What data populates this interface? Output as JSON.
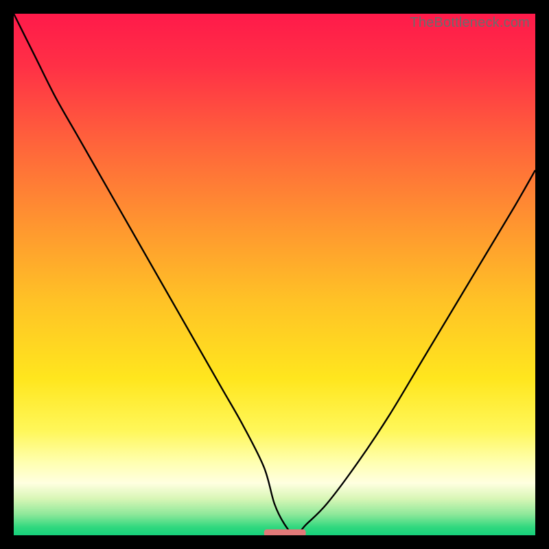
{
  "watermark": "TheBottleneck.com",
  "chart_data": {
    "type": "line",
    "title": "",
    "xlabel": "",
    "ylabel": "",
    "xlim": [
      0,
      100
    ],
    "ylim": [
      0,
      100
    ],
    "legend": false,
    "grid": false,
    "background_gradient": {
      "stops": [
        {
          "offset": 0.0,
          "color": "#ff1a4a"
        },
        {
          "offset": 0.1,
          "color": "#ff3046"
        },
        {
          "offset": 0.25,
          "color": "#ff643b"
        },
        {
          "offset": 0.4,
          "color": "#ff9430"
        },
        {
          "offset": 0.55,
          "color": "#ffc226"
        },
        {
          "offset": 0.7,
          "color": "#ffe61e"
        },
        {
          "offset": 0.8,
          "color": "#fff75a"
        },
        {
          "offset": 0.86,
          "color": "#ffffb0"
        },
        {
          "offset": 0.9,
          "color": "#ffffe0"
        },
        {
          "offset": 0.93,
          "color": "#d8f6b6"
        },
        {
          "offset": 0.96,
          "color": "#8de89a"
        },
        {
          "offset": 0.985,
          "color": "#2fd87e"
        },
        {
          "offset": 1.0,
          "color": "#16cf7b"
        }
      ]
    },
    "series": [
      {
        "name": "bottleneck-curve",
        "color": "#000000",
        "x": [
          0,
          4,
          8,
          12,
          16,
          20,
          24,
          28,
          32,
          36,
          40,
          44,
          48,
          50,
          52,
          54,
          56,
          60,
          66,
          72,
          78,
          84,
          90,
          96,
          100
        ],
        "y": [
          100,
          92,
          84,
          77,
          70,
          63,
          56,
          49,
          42,
          35,
          28,
          21,
          13,
          6,
          2,
          0,
          2,
          6,
          14,
          23,
          33,
          43,
          53,
          63,
          70
        ]
      }
    ],
    "marker": {
      "name": "optimal-marker",
      "color": "#e17878",
      "x": 52,
      "y": 0,
      "width": 8,
      "height": 1.4
    }
  }
}
